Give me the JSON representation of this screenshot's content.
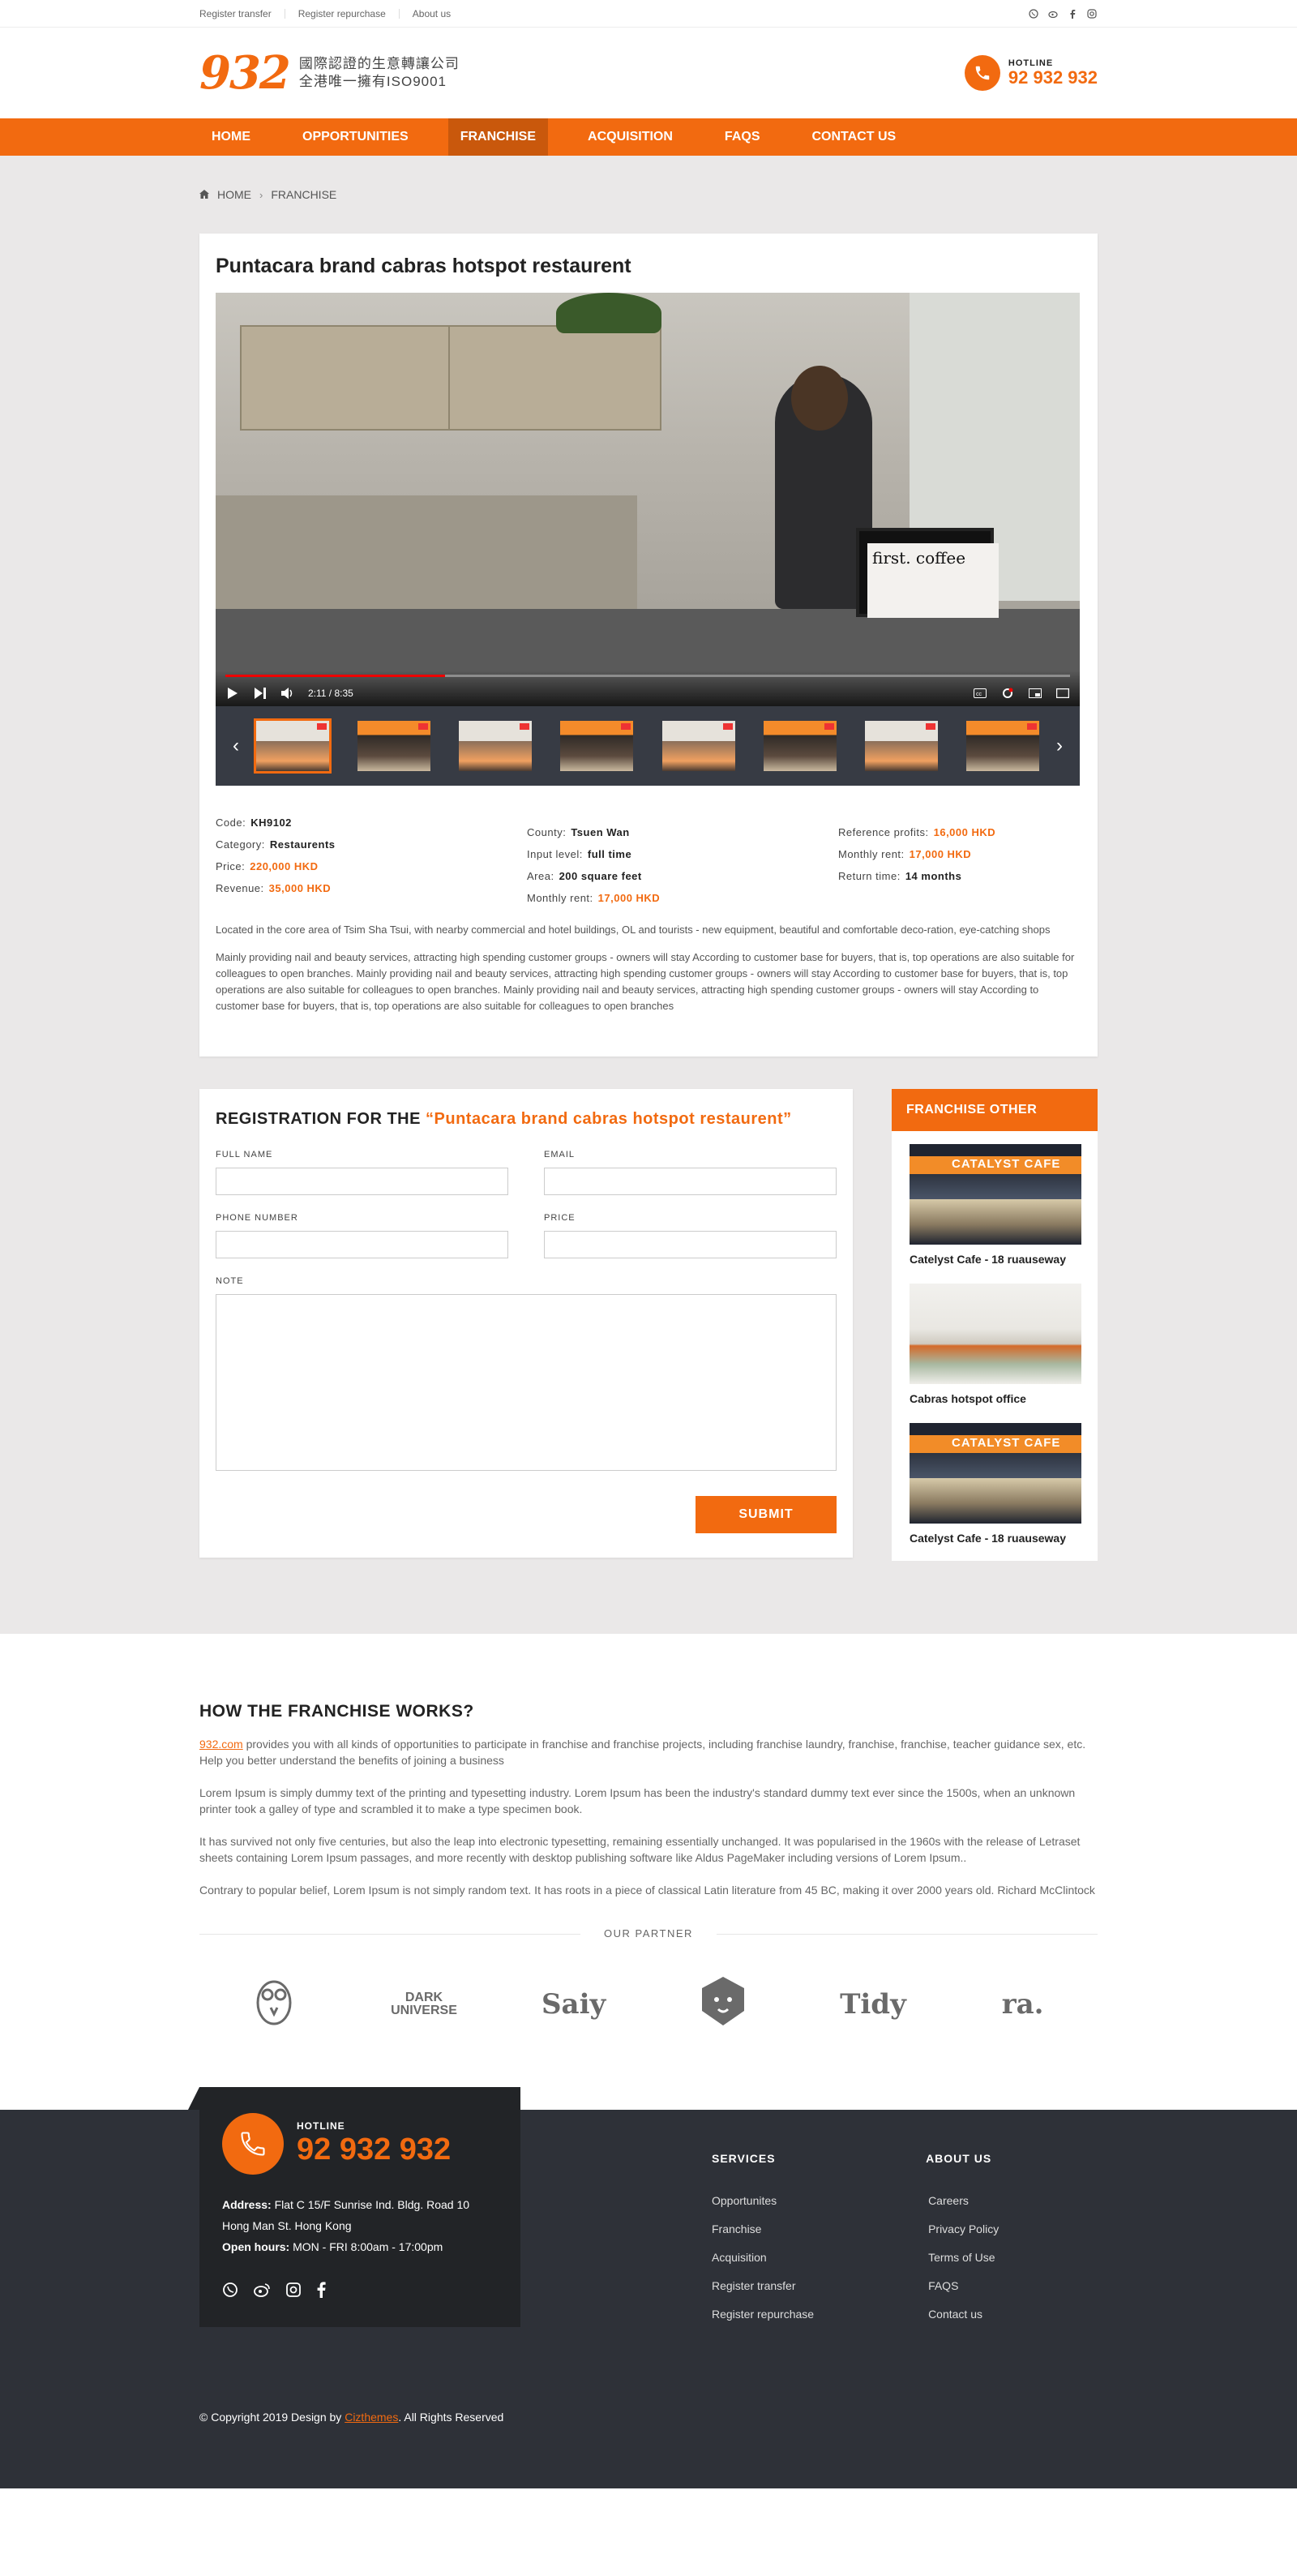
{
  "topbar": {
    "links": [
      "Register transfer",
      "Register repurchase",
      "About us"
    ],
    "social_icons": [
      "whatsapp-icon",
      "weibo-icon",
      "facebook-icon",
      "instagram-icon"
    ]
  },
  "header": {
    "logo_num": "932",
    "logo_line1": "國際認證的生意轉讓公司",
    "logo_line2": "全港唯一擁有ISO9001",
    "hotline_label": "HOTLINE",
    "hotline_number": "92 932 932"
  },
  "nav": {
    "items": [
      "HOME",
      "OPPORTUNITIES",
      "FRANCHISE",
      "ACQUISITION",
      "FAQS",
      "CONTACT US"
    ],
    "active": "FRANCHISE"
  },
  "breadcrumb": {
    "home": "HOME",
    "current": "FRANCHISE"
  },
  "listing": {
    "title": "Puntacara brand cabras hotspot restaurent",
    "video": {
      "time": "2:11 / 8:35",
      "progress": 0.26
    },
    "details": {
      "code_label": "Code:",
      "code": "KH9102",
      "category_label": "Category:",
      "category": "Restaurents",
      "price_label": "Price:",
      "price": "220,000 HKD",
      "revenue_label": "Revenue:",
      "revenue": "35,000 HKD",
      "county_label": "County:",
      "county": "Tsuen Wan",
      "input_label": "Input level:",
      "input": "full time",
      "area_label": "Area:",
      "area": "200 square feet",
      "monthly_rent_label": "Monthly rent:",
      "monthly_rent": "17,000 HKD",
      "ref_profit_label": "Reference profits:",
      "ref_profit": "16,000 HKD",
      "monthly_rent2_label": "Monthly rent:",
      "monthly_rent2": "17,000 HKD",
      "return_label": "Return time:",
      "return_time": "14 months"
    },
    "desc1": "Located in the core area of Tsim Sha Tsui, with nearby commercial and hotel buildings, OL and tourists - new equipment, beautiful and comfortable deco-ration, eye-catching shops",
    "desc2": "Mainly providing nail and beauty services, attracting high spending customer groups - owners will stay According to customer base for buyers, that is, top operations are also suitable for colleagues to open branches. Mainly providing nail and beauty services, attracting high spending customer groups - owners will stay According to customer base for buyers, that is, top operations are also suitable for colleagues to open branches. Mainly providing nail and beauty services, attracting high spending customer groups - owners will stay According to customer base for buyers, that is, top operations are also suitable for colleagues to open branches"
  },
  "registration": {
    "title_prefix": "REGISTRATION FOR THE",
    "title_highlight": "“Puntacara brand cabras hotspot restaurent”",
    "full_name_label": "FULL NAME",
    "email_label": "EMAIL",
    "phone_label": "PHONE NUMBER",
    "price_label": "PRICE",
    "note_label": "NOTE",
    "submit_label": "SUBMIT"
  },
  "sidebar": {
    "title": "FRANCHISE OTHER",
    "items": [
      {
        "caption": "Catelyst Cafe - 18 ruauseway",
        "sign": "CATALYST CAFE"
      },
      {
        "caption": "Cabras hotspot office"
      },
      {
        "caption": "Catelyst Cafe - 18 ruauseway",
        "sign": "CATALYST CAFE"
      }
    ]
  },
  "how": {
    "title": "HOW THE FRANCHISE WORKS?",
    "link": "932.com",
    "p1": " provides you with all kinds of opportunities to participate in franchise and franchise projects, including franchise laundry, franchise, franchise, teacher guidance sex, etc. Help you better understand the benefits of joining a business",
    "p2": "Lorem Ipsum is simply dummy text of the printing and typesetting industry. Lorem Ipsum has been the industry's standard dummy text ever since the 1500s, when an unknown printer took a galley of type and scrambled it to make a type specimen book.",
    "p3": "It has survived not only five centuries, but also the leap into electronic typesetting, remaining essentially unchanged. It was popularised in the 1960s with the release of Letraset sheets containing Lorem Ipsum passages, and more recently with desktop publishing software like Aldus PageMaker including versions of Lorem Ipsum..",
    "p4": "Contrary to popular belief, Lorem Ipsum is not simply random text. It has roots in a piece of classical Latin literature from 45 BC, making it over 2000 years old. Richard McClintock",
    "partner_title": "OUR PARTNER",
    "partners": [
      "owl-logo",
      "DARK UNIVERSE",
      "Saiy",
      "lion-logo",
      "Tidy",
      "ra."
    ]
  },
  "footer": {
    "hotline_label": "HOTLINE",
    "hotline_number": "92 932 932",
    "address_label": "Address:",
    "address": "Flat C 15/F Sunrise Ind. Bldg.  Road 10 Hong Man St. Hong Kong",
    "hours_label": "Open hours:",
    "hours": "MON - FRI  8:00am - 17:00pm",
    "services_title": "SERVICES",
    "services": [
      "Opportunites",
      "Franchise",
      "Acquisition",
      "Register transfer",
      "Register repurchase"
    ],
    "about_title": "ABOUT US",
    "about": [
      "Careers",
      "Privacy Policy",
      "Terms of Use",
      "FAQS",
      "Contact us"
    ],
    "copyright_prefix": "© Copyright 2019 Design by",
    "copyright_brand": "Cizthemes",
    "copyright_suffix": "All Rights Reserved"
  }
}
